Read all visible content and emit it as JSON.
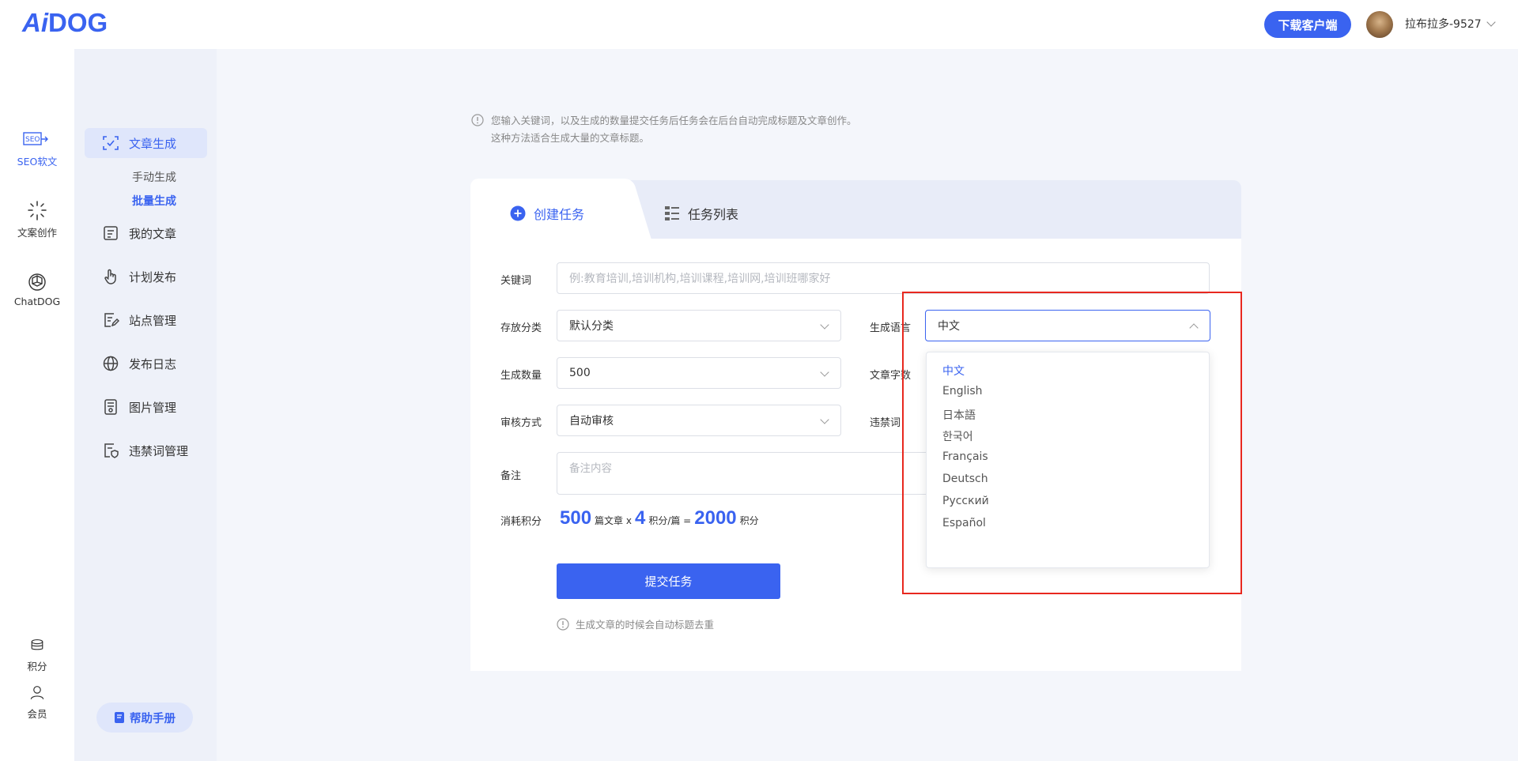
{
  "brand": {
    "logo_text_ai": "Ai",
    "logo_text_dog": "DOG",
    "accent": "#3a63f0"
  },
  "header": {
    "download_label": "下载客户端",
    "username": "拉布拉多-9527"
  },
  "rail": {
    "items": [
      {
        "label": "SEO软文",
        "icon": "seo-icon"
      },
      {
        "label": "文案创作",
        "icon": "sparkle-icon"
      },
      {
        "label": "ChatDOG",
        "icon": "openai-icon"
      },
      {
        "label": "积分",
        "icon": "coins-icon"
      },
      {
        "label": "会员",
        "icon": "user-icon"
      }
    ]
  },
  "sidebar": {
    "items": [
      {
        "label": "文章生成",
        "icon": "scan-check-icon"
      },
      {
        "label": "我的文章",
        "icon": "note-icon"
      },
      {
        "label": "计划发布",
        "icon": "hand-icon"
      },
      {
        "label": "站点管理",
        "icon": "edit-doc-icon"
      },
      {
        "label": "发布日志",
        "icon": "globe-icon"
      },
      {
        "label": "图片管理",
        "icon": "image-doc-icon"
      },
      {
        "label": "违禁词管理",
        "icon": "shield-doc-icon"
      }
    ],
    "children": {
      "manual": "手动生成",
      "batch": "批量生成"
    },
    "help_label": "帮助手册"
  },
  "notice": {
    "line1": "您输入关键词，以及生成的数量提交任务后任务会在后台自动完成标题及文章创作。",
    "line2": "这种方法适合生成大量的文章标题。"
  },
  "tabs": {
    "create": "创建任务",
    "list": "任务列表"
  },
  "form": {
    "keyword_label": "关键词",
    "keyword_placeholder": "例:教育培训,培训机构,培训课程,培训网,培训班哪家好",
    "category_label": "存放分类",
    "category_value": "默认分类",
    "language_label": "生成语言",
    "language_value": "中文",
    "count_label": "生成数量",
    "count_value": "500",
    "wordcount_label": "文章字数",
    "review_label": "审核方式",
    "review_value": "自动审核",
    "banned_label": "违禁词",
    "note_label": "备注",
    "note_placeholder": "备注内容",
    "cost_label": "消耗积分",
    "cost_count": "500",
    "cost_unit1": "篇文章 x",
    "cost_rate": "4",
    "cost_unit2": "积分/篇 =",
    "cost_total": "2000",
    "cost_unit3": "积分",
    "submit_label": "提交任务",
    "tip": "生成文章的时候会自动标题去重"
  },
  "language_options": [
    "中文",
    "English",
    "日本語",
    "한국어",
    "Français",
    "Deutsch",
    "Русский",
    "Español"
  ]
}
